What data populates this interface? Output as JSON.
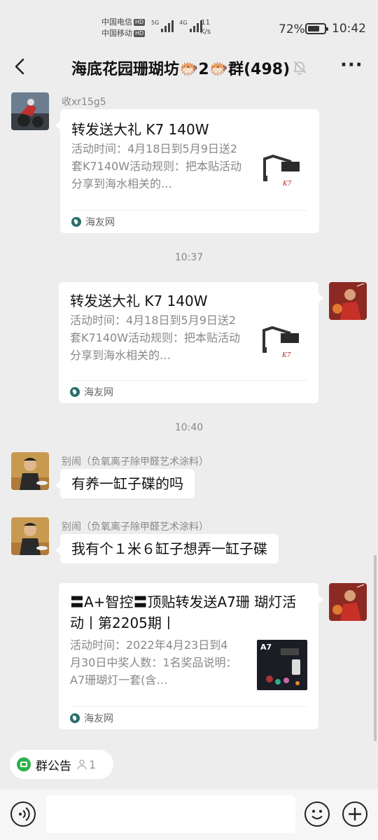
{
  "status_bar": {
    "carrier1": "中国电信",
    "carrier2": "中国移动",
    "hd": "HD",
    "sig1_tag": "5G",
    "sig2_tag": "4G",
    "net_speed_value": "11",
    "net_speed_unit": "K/s",
    "battery_percent": "72%",
    "battery_level": 0.72,
    "time": "10:42"
  },
  "header": {
    "back_icon": "chevron-left-icon",
    "title": "海底花园珊瑚坊🐡2🐡群(498)",
    "mute_icon": "bell-off-icon",
    "more_icon": "more-dots-icon",
    "more_label": "···"
  },
  "messages": {
    "m1": {
      "sender": "收xr15g5",
      "title": "转发送大礼 K7 140W",
      "desc": "活动时间：4月18日到5月9日送2套K7140W活动规则：把本贴活动分享到海水相关的…",
      "source": "海友网"
    },
    "t1": "10:37",
    "m2": {
      "title": "转发送大礼 K7 140W",
      "desc": "活动时间：4月18日到5月9日送2套K7140W活动规则：把本贴活动分享到海水相关的…",
      "source": "海友网"
    },
    "t2": "10:40",
    "m3": {
      "sender": "别闹（负氧离子除甲醛艺术涂料）",
      "text": "有养一缸子碟的吗"
    },
    "m4": {
      "sender": "别闹（负氧离子除甲醛艺术涂料）",
      "text": "我有个１米６缸子想弄一缸子碟"
    },
    "m5": {
      "title": "〓A+智控〓顶贴转发送A7珊 瑚灯活动丨第2205期丨",
      "desc": "活动时间：2022年4月23日到4月30日中奖人数：1名奖品说明：A7珊瑚灯一套(含…",
      "source": "海友网",
      "thumb_label": "A7"
    }
  },
  "bottom": {
    "announcement_label": "群公告",
    "announcement_count": "1",
    "input_placeholder": ""
  },
  "colors": {
    "background": "#ededed",
    "bubble": "#ffffff",
    "accent_green": "#2bb24c"
  }
}
